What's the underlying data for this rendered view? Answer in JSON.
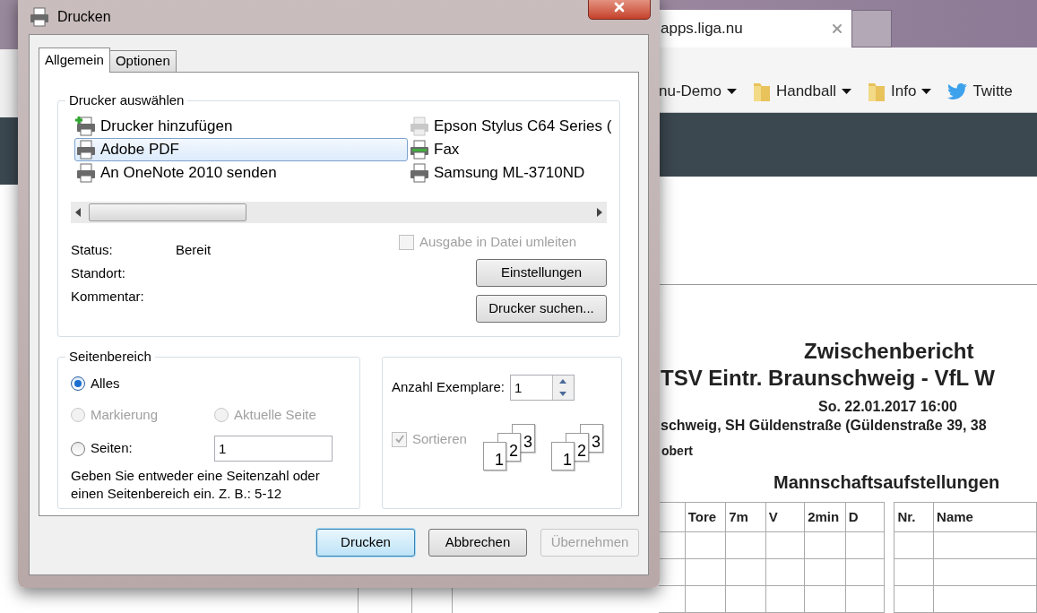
{
  "browser": {
    "tab": {
      "title": "apps.liga.nu"
    },
    "bookmarks": [
      {
        "label": "nu-Demo",
        "kind": "plain",
        "dropdown": true
      },
      {
        "label": "Handball",
        "kind": "folder",
        "dropdown": true
      },
      {
        "label": "Info",
        "kind": "folder",
        "dropdown": true
      },
      {
        "label": "Twitte",
        "kind": "social",
        "dropdown": false
      }
    ]
  },
  "document": {
    "title": "Zwischenbericht",
    "match": "TSV Eintr. Braunschweig - VfL W",
    "date": "So. 22.01.2017 16:00",
    "venue": "schweig, SH Güldenstraße (Güldenstraße 39, 38",
    "referee": "obert",
    "section": "Mannschaftsaufstellungen",
    "left_columns": [
      "Tore",
      "7m",
      "V",
      "2min",
      "D"
    ],
    "right_columns": [
      "Nr.",
      "Name"
    ]
  },
  "dialog": {
    "title": "Drucken",
    "tabs": [
      {
        "label": "Allgemein",
        "selected": true
      },
      {
        "label": "Optionen",
        "selected": false
      }
    ],
    "printer_group": {
      "title": "Drucker auswählen",
      "printers": [
        {
          "name": "Drucker hinzufügen",
          "kind": "add",
          "selected": false
        },
        {
          "name": "Adobe PDF",
          "kind": "printer",
          "selected": true
        },
        {
          "name": "An OneNote 2010 senden",
          "kind": "printer",
          "selected": false
        },
        {
          "name": "Epson Stylus C64 Series (",
          "kind": "offline",
          "selected": false
        },
        {
          "name": "Fax",
          "kind": "fax",
          "selected": false
        },
        {
          "name": "Samsung ML-3710ND",
          "kind": "printer",
          "selected": false
        }
      ],
      "info": [
        {
          "label": "Status:",
          "value": "Bereit"
        },
        {
          "label": "Standort:"
        },
        {
          "label": "Kommentar:"
        }
      ],
      "print_to_file": {
        "label": "Ausgabe in Datei umleiten",
        "checked": false,
        "disabled": true
      },
      "buttons": [
        "Einstellungen",
        "Drucker suchen..."
      ]
    },
    "page_range": {
      "title": "Seitenbereich",
      "options": [
        {
          "label": "Alles",
          "selected": true,
          "disabled": false
        },
        {
          "label": "Markierung",
          "selected": false,
          "disabled": true
        },
        {
          "label": "Aktuelle Seite",
          "selected": false,
          "disabled": true
        },
        {
          "label": "Seiten:",
          "selected": false,
          "disabled": false
        }
      ],
      "pages_value": "1",
      "hint": "Geben Sie entweder eine Seitenzahl oder einen Seitenbereich ein. Z. B.: 5-12"
    },
    "copies": {
      "label": "Anzahl Exemplare:",
      "value": "1",
      "collate": {
        "label": "Sortieren",
        "checked": true,
        "disabled": true
      },
      "stacks": [
        {
          "pages": [
            "1",
            "2",
            "3"
          ]
        },
        {
          "pages": [
            "1",
            "2",
            "3"
          ]
        }
      ]
    },
    "footer_buttons": [
      {
        "label": "Drucken",
        "default": true,
        "disabled": false
      },
      {
        "label": "Abbrechen",
        "default": false,
        "disabled": false
      },
      {
        "label": "Übernehmen",
        "default": false,
        "disabled": true
      }
    ]
  }
}
